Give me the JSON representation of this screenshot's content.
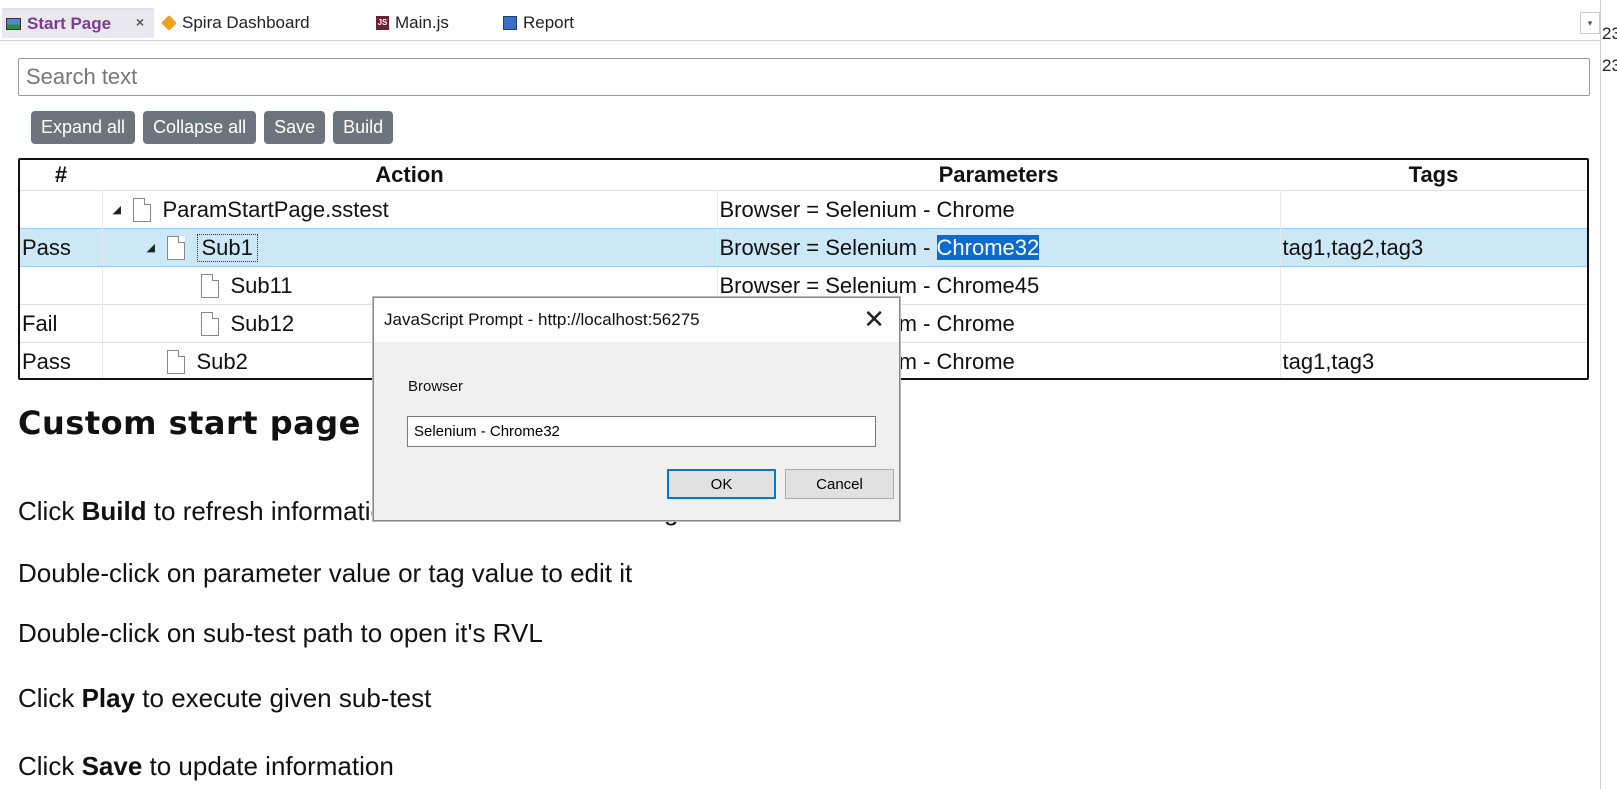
{
  "tabs": [
    {
      "label": "Start Page",
      "close": "×"
    },
    {
      "label": "Spira Dashboard"
    },
    {
      "label": "Main.js",
      "icon_text": "JS"
    },
    {
      "label": "Report"
    }
  ],
  "tab_scroll": "▾",
  "right_edge": [
    "23",
    "23"
  ],
  "search": {
    "placeholder": "Search text"
  },
  "toolbar": {
    "expand_all": "Expand all",
    "collapse_all": "Collapse all",
    "save": "Save",
    "build": "Build"
  },
  "table": {
    "headers": [
      "#",
      "Action",
      "Parameters",
      "Tags"
    ],
    "rows": [
      {
        "status": "",
        "action": "ParamStartPage.sstest",
        "params": "Browser = Selenium - Chrome",
        "tags": ""
      },
      {
        "status": "Pass",
        "action": "Sub1",
        "params_prefix": "Browser = Selenium - ",
        "params_highlight": "Chrome32",
        "tags": "tag1,tag2,tag3"
      },
      {
        "status": "",
        "action": "Sub11",
        "params": "Browser = Selenium - Chrome45",
        "tags": ""
      },
      {
        "status": "Fail",
        "action": "Sub12",
        "params": "Browser = Selenium - Chrome",
        "tags": ""
      },
      {
        "status": "Pass",
        "action": "Sub2",
        "params": "Browser = Selenium - Chrome",
        "tags": "tag1,tag3"
      }
    ]
  },
  "content": {
    "heading": "Custom start page",
    "p1": {
      "a": "Click ",
      "b": "Build",
      "c": " to refresh information about sub-tests and tags"
    },
    "p2": "Double-click on parameter value or tag value to edit it",
    "p3": "Double-click on sub-test path to open it's RVL",
    "p4": {
      "a": "Click ",
      "b": "Play",
      "c": " to execute given sub-test"
    },
    "p5": {
      "a": "Click ",
      "b": "Save",
      "c": " to update information"
    }
  },
  "dialog": {
    "title": "JavaScript Prompt - http://localhost:56275",
    "close": "✕",
    "label": "Browser",
    "value": "Selenium - Chrome32",
    "ok": "OK",
    "cancel": "Cancel"
  }
}
